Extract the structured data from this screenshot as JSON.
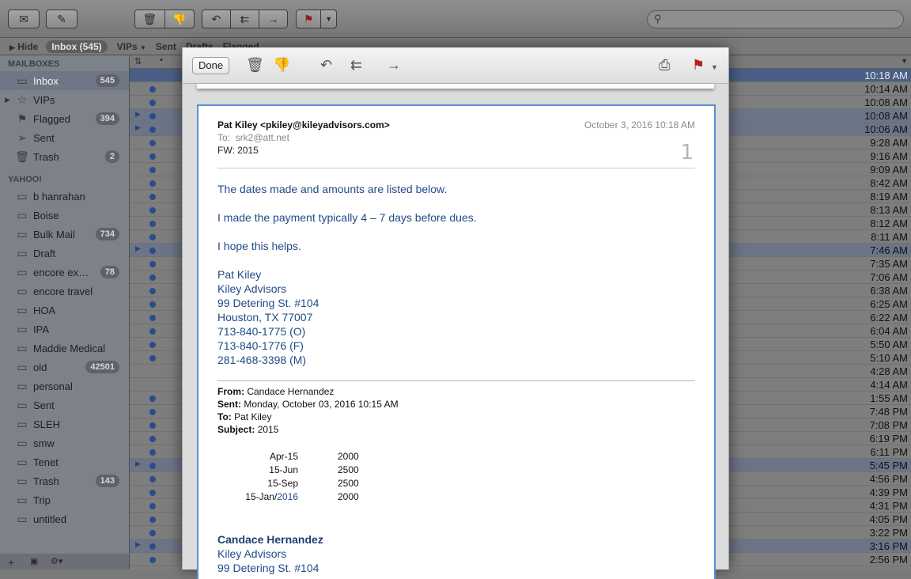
{
  "toolbar": {
    "icons": [
      "compose-envelope-icon",
      "new-note-icon",
      "trash-icon",
      "junk-icon",
      "reply-icon",
      "reply-all-icon",
      "forward-icon",
      "flag-icon",
      "chevron-down-icon"
    ],
    "search_placeholder": ""
  },
  "favorites": {
    "hide": "Hide",
    "inbox": "Inbox (545)",
    "vips": "VIPs",
    "sent": "Sent",
    "drafts": "Drafts",
    "flagged": "Flagged"
  },
  "sidebar": {
    "mailboxes_header": "MAILBOXES",
    "mailboxes": [
      {
        "label": "Inbox",
        "badge": "545"
      },
      {
        "label": "VIPs",
        "badge": ""
      },
      {
        "label": "Flagged",
        "badge": "394"
      },
      {
        "label": "Sent",
        "badge": ""
      },
      {
        "label": "Trash",
        "badge": "2"
      }
    ],
    "account_header": "YAHOO!",
    "folders": [
      {
        "label": "b hanrahan",
        "badge": ""
      },
      {
        "label": "Boise",
        "badge": ""
      },
      {
        "label": "Bulk Mail",
        "badge": "734"
      },
      {
        "label": "Draft",
        "badge": ""
      },
      {
        "label": "encore ex…",
        "badge": "78"
      },
      {
        "label": "encore travel",
        "badge": ""
      },
      {
        "label": "HOA",
        "badge": ""
      },
      {
        "label": "IPA",
        "badge": ""
      },
      {
        "label": "Maddie Medical",
        "badge": ""
      },
      {
        "label": "old",
        "badge": "42501"
      },
      {
        "label": "personal",
        "badge": ""
      },
      {
        "label": "Sent",
        "badge": ""
      },
      {
        "label": "SLEH",
        "badge": ""
      },
      {
        "label": "smw",
        "badge": ""
      },
      {
        "label": "Tenet",
        "badge": ""
      },
      {
        "label": "Trash",
        "badge": "143"
      },
      {
        "label": "Trip",
        "badge": ""
      },
      {
        "label": "untitled",
        "badge": ""
      }
    ]
  },
  "message_list": {
    "times": [
      "10:18 AM",
      "10:14 AM",
      "10:08 AM",
      "10:08 AM",
      "10:06 AM",
      "9:28 AM",
      "9:16 AM",
      "9:09 AM",
      "8:42 AM",
      "8:19 AM",
      "8:13 AM",
      "8:12 AM",
      "8:11 AM",
      "7:46 AM",
      "7:35 AM",
      "7:06 AM",
      "6:38 AM",
      "6:25 AM",
      "6:22 AM",
      "6:04 AM",
      "5:50 AM",
      "5:10 AM",
      "4:28 AM",
      "4:14 AM",
      "1:55 AM",
      "7:48 PM",
      "7:08 PM",
      "6:19 PM",
      "6:11 PM",
      "5:45 PM",
      "4:56 PM",
      "4:39 PM",
      "4:31 PM",
      "4:05 PM",
      "3:22 PM",
      "3:16 PM",
      "2:56 PM"
    ]
  },
  "viewer": {
    "done_label": "Done",
    "from": "Pat Kiley <pkiley@kileyadvisors.com>",
    "date": "October 3, 2016  10:18 AM",
    "to_label": "To:",
    "to": "srk2@att.net",
    "subject": "FW: 2015",
    "count": "1",
    "body": [
      "The dates made and amounts are listed below.",
      "I made the payment typically 4 – 7 days before dues.",
      "I hope this helps."
    ],
    "signature": [
      "Pat Kiley",
      "Kiley Advisors",
      "99 Detering St. #104",
      "Houston, TX 77007",
      "713-840-1775 (O)",
      "713-840-1776 (F)",
      "281-468-3398 (M)"
    ],
    "forward": {
      "from_label": "From:",
      "from": "Candace Hernandez",
      "sent_label": "Sent:",
      "sent": "Monday, October 03, 2016 10:15 AM",
      "to_label": "To:",
      "to": "Pat Kiley",
      "subject_label": "Subject:",
      "subject": "2015"
    },
    "payments": [
      {
        "date": "Apr-15",
        "amount": "2000"
      },
      {
        "date": "15-Jun",
        "amount": "2500"
      },
      {
        "date": "15-Sep",
        "amount": "2500"
      },
      {
        "date_prefix": "15-Jan/",
        "date_link": "2016",
        "amount": "2000"
      }
    ],
    "signature2": [
      "Candace Hernandez",
      "Kiley Advisors",
      "99 Detering St. #104"
    ]
  }
}
